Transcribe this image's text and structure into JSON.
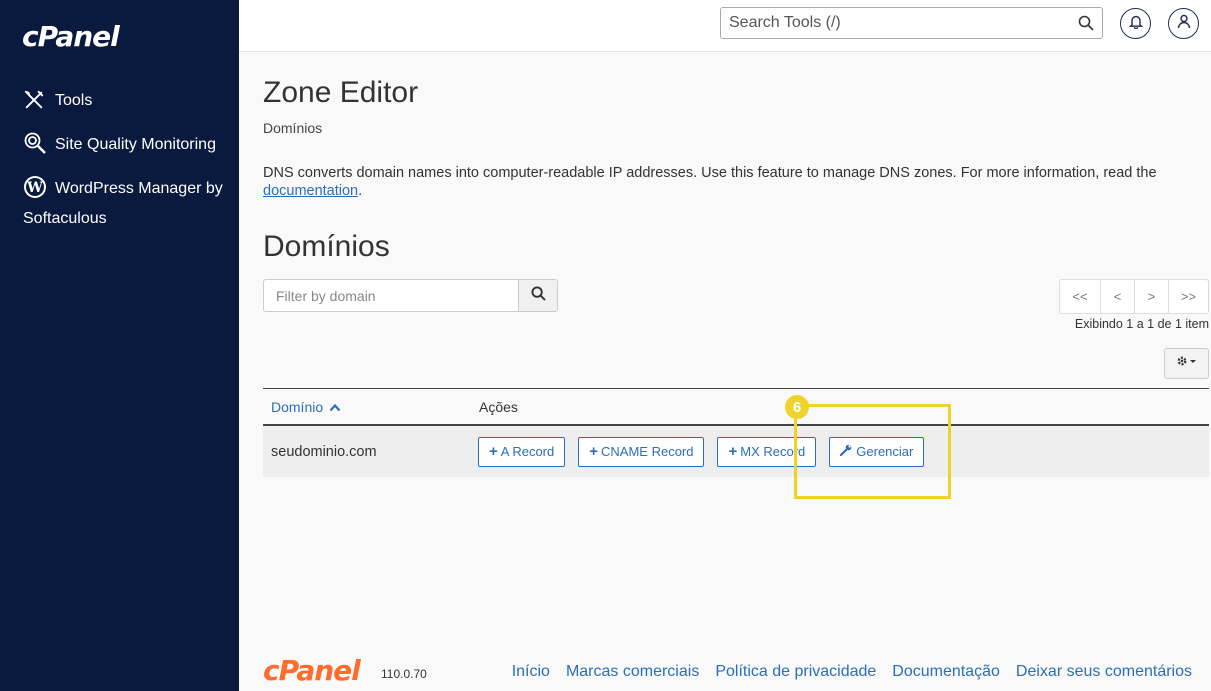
{
  "sidebar": {
    "logo": "cPanel",
    "items": [
      {
        "label": "Tools",
        "icon": "tools-icon"
      },
      {
        "label": "Site Quality Monitoring",
        "icon": "magnifier-icon"
      },
      {
        "label": "WordPress Manager by Softaculous",
        "icon": "wordpress-icon"
      }
    ]
  },
  "header": {
    "search_placeholder": "Search Tools (/)"
  },
  "page": {
    "title": "Zone Editor",
    "breadcrumb": "Domínios",
    "description": "DNS converts domain names into computer-readable IP addresses. Use this feature to manage DNS zones. For more information, read the ",
    "description_link": "documentation",
    "description_end": ".",
    "section_title": "Domínios",
    "filter_placeholder": "Filter by domain",
    "pager": {
      "first": "<<",
      "prev": "<",
      "next": ">",
      "last": ">>"
    },
    "showing": "Exibindo 1 a 1 de 1 item"
  },
  "table": {
    "columns": {
      "domain": "Domínio",
      "actions": "Ações"
    },
    "rows": [
      {
        "domain": "seudominio.com",
        "actions": [
          "A Record",
          "CNAME Record",
          "MX Record",
          "Gerenciar"
        ]
      }
    ]
  },
  "annotation": {
    "step": "6",
    "color": "#efd22a"
  },
  "footer": {
    "logo": "cPanel",
    "version": "110.0.70",
    "links": [
      "Início",
      "Marcas comerciais",
      "Política de privacidade",
      "Documentação",
      "Deixar seus comentários"
    ]
  }
}
